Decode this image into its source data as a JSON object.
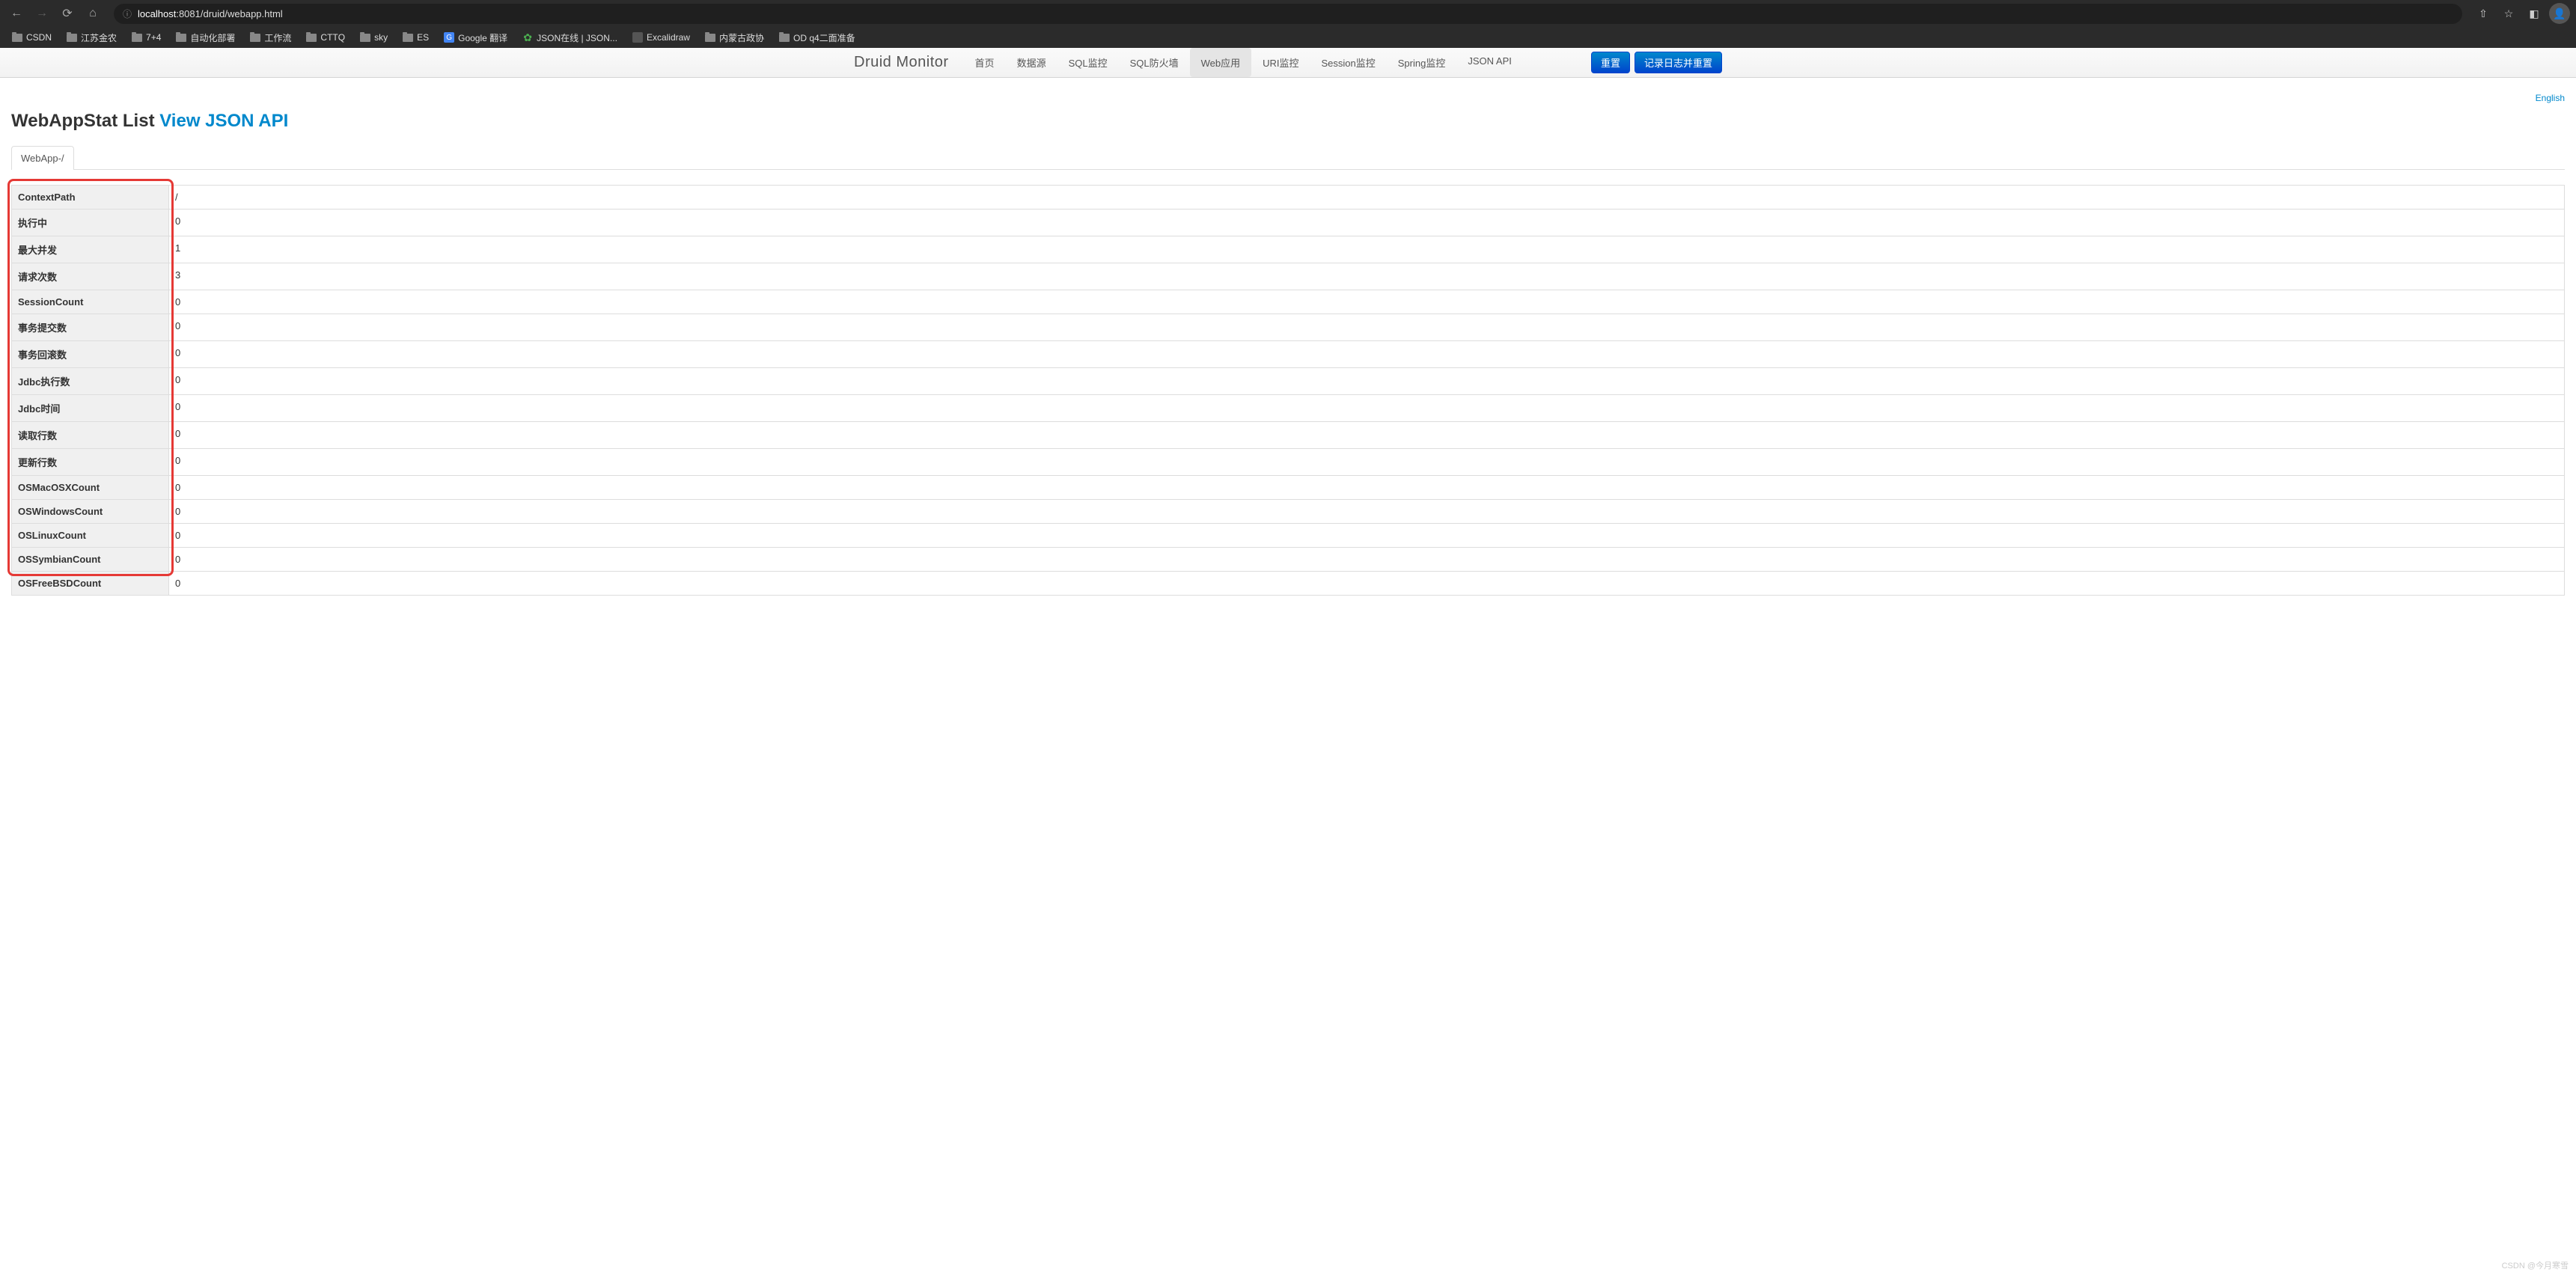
{
  "browser": {
    "url_host": "localhost",
    "url_rest": ":8081/druid/webapp.html",
    "bookmarks": [
      {
        "label": "CSDN",
        "icon": "folder"
      },
      {
        "label": "江苏金农",
        "icon": "folder"
      },
      {
        "label": "7+4",
        "icon": "folder"
      },
      {
        "label": "自动化部署",
        "icon": "folder"
      },
      {
        "label": "工作流",
        "icon": "folder"
      },
      {
        "label": "CTTQ",
        "icon": "folder"
      },
      {
        "label": "sky",
        "icon": "folder"
      },
      {
        "label": "ES",
        "icon": "folder"
      },
      {
        "label": "Google 翻译",
        "icon": "blue"
      },
      {
        "label": "JSON在线 | JSON...",
        "icon": "green"
      },
      {
        "label": "Excalidraw",
        "icon": "gray"
      },
      {
        "label": "内蒙古政协",
        "icon": "folder"
      },
      {
        "label": "OD q4二面准备",
        "icon": "folder"
      }
    ]
  },
  "navbar": {
    "brand": "Druid Monitor",
    "items": [
      {
        "label": "首页",
        "active": false
      },
      {
        "label": "数据源",
        "active": false
      },
      {
        "label": "SQL监控",
        "active": false
      },
      {
        "label": "SQL防火墙",
        "active": false
      },
      {
        "label": "Web应用",
        "active": true
      },
      {
        "label": "URI监控",
        "active": false
      },
      {
        "label": "Session监控",
        "active": false
      },
      {
        "label": "Spring监控",
        "active": false
      },
      {
        "label": "JSON API",
        "active": false
      }
    ],
    "btn_reset": "重置",
    "btn_log_reset": "记录日志并重置"
  },
  "page": {
    "lang_link": "English",
    "title_text": "WebAppStat List",
    "title_link": "View JSON API",
    "tab_label": "WebApp-/",
    "watermark": "CSDN @今月寒雪"
  },
  "stats": [
    {
      "label": "ContextPath",
      "value": "/"
    },
    {
      "label": "执行中",
      "value": "0"
    },
    {
      "label": "最大并发",
      "value": "1"
    },
    {
      "label": "请求次数",
      "value": "3"
    },
    {
      "label": "SessionCount",
      "value": "0"
    },
    {
      "label": "事务提交数",
      "value": "0"
    },
    {
      "label": "事务回滚数",
      "value": "0"
    },
    {
      "label": "Jdbc执行数",
      "value": "0"
    },
    {
      "label": "Jdbc时间",
      "value": "0"
    },
    {
      "label": "读取行数",
      "value": "0"
    },
    {
      "label": "更新行数",
      "value": "0"
    },
    {
      "label": "OSMacOSXCount",
      "value": "0"
    },
    {
      "label": "OSWindowsCount",
      "value": "0"
    },
    {
      "label": "OSLinuxCount",
      "value": "0"
    },
    {
      "label": "OSSymbianCount",
      "value": "0"
    },
    {
      "label": "OSFreeBSDCount",
      "value": "0"
    }
  ]
}
